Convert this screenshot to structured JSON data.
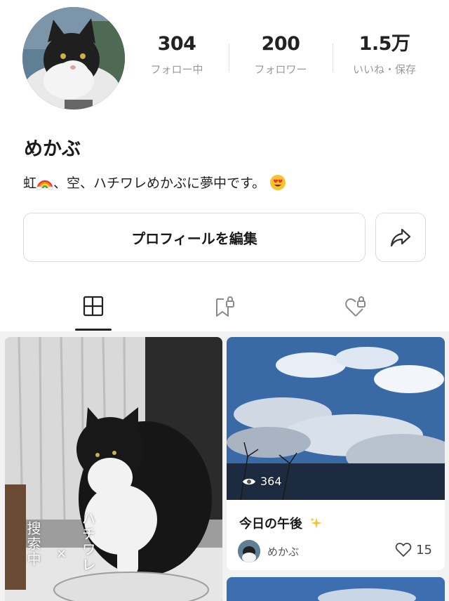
{
  "profile": {
    "name": "めかぶ",
    "bio_prefix": "虹",
    "bio_middle": "、空、ハチワレめかぶに夢中です。"
  },
  "stats": [
    {
      "value": "304",
      "label": "フォロー中"
    },
    {
      "value": "200",
      "label": "フォロワー"
    },
    {
      "value": "1.5万",
      "label": "いいね・保存"
    }
  ],
  "actions": {
    "edit_label": "プロフィールを編集"
  },
  "tabs": [
    {
      "icon": "grid-icon",
      "active": true
    },
    {
      "icon": "bookmark-lock-icon",
      "active": false
    },
    {
      "icon": "heart-lock-icon",
      "active": false
    }
  ],
  "posts": {
    "left": {
      "overlay_text_1": "ハチワレ",
      "overlay_text_2": "搜索中",
      "overlay_sep": "×"
    },
    "right": {
      "views": "364",
      "title": "今日の午後",
      "author": "めかぶ",
      "likes": "15"
    }
  },
  "colors": {
    "accent_dark": "#222222",
    "muted_text": "#9a9a9a",
    "border": "#dcdcdc"
  }
}
